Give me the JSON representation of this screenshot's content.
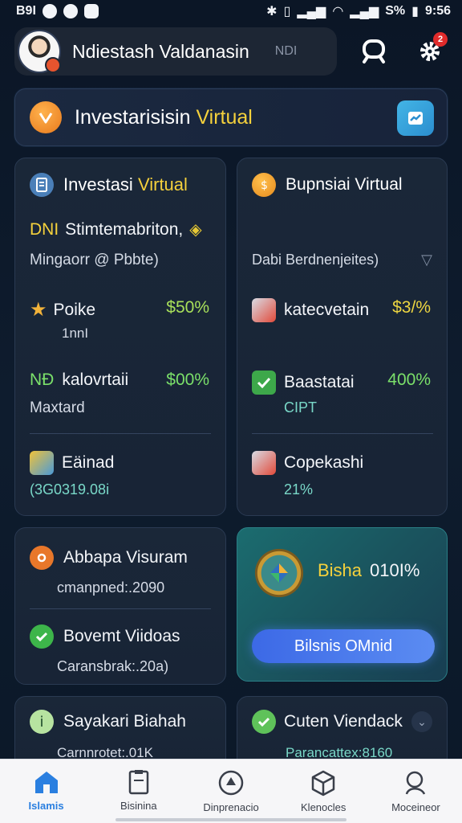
{
  "status_bar": {
    "left_text": "B9I",
    "battery_text": "S%",
    "time": "9:56"
  },
  "header": {
    "username": "Ndiestash Valdanasin",
    "tag": "NDI",
    "notification_count": "2"
  },
  "banner": {
    "title_main": "Investarisisin",
    "title_highlight": "Virtual"
  },
  "left_card": {
    "title_main": "Investasi",
    "title_highlight": "Virtual",
    "line1_prefix": "DNI",
    "line1": "Stimtemabriton,",
    "line2": "Mingaorr @ Pbbte)",
    "item1_label": "Poike",
    "item1_value": "$50%",
    "item1_sub": "1nnI",
    "item2_prefix": "NÐ",
    "item2_label": "kalovrtaii",
    "item2_value": "$00%",
    "item2_sub": "Maxtard",
    "item3_label": "Eäinad",
    "item3_sub": "(3G0319.08i"
  },
  "right_card": {
    "title": "Bupnsiai Virtual",
    "dropdown_value": "Dabi Berdnenjeites)",
    "item1_label": "katecvetain",
    "item1_value": "$3/%",
    "item2_label": "Baastatai",
    "item2_value": "400%",
    "item2_sub": "CIPT",
    "item3_label": "Copekashi",
    "item3_sub": "21%"
  },
  "left_mid_card": {
    "item1_label": "Abbapa Visuram",
    "item1_sub": "cmanpned:.2090",
    "item2_label": "Bovemt Viidoas",
    "item2_sub": "Caransbrak:.20a)"
  },
  "promo_card": {
    "label": "Bisha",
    "value": "010I%",
    "button_label": "Bilsnis OMnid"
  },
  "left_low_card": {
    "label": "Sayakari Biahah",
    "sub": "Carnnrotet:.01K"
  },
  "right_low_card": {
    "label": "Cuten Viendack",
    "sub": "Parancattex:8160"
  },
  "bottom_nav": [
    {
      "label": "Islamis",
      "icon": "home-icon"
    },
    {
      "label": "Bisinina",
      "icon": "document-icon"
    },
    {
      "label": "Dinprenacio",
      "icon": "compass-icon"
    },
    {
      "label": "Klenocles",
      "icon": "box-icon"
    },
    {
      "label": "Moceineor",
      "icon": "profile-icon"
    }
  ],
  "colors": {
    "background": "#0b1626",
    "card": "#1a2738",
    "accent_yellow": "#f5d13c",
    "accent_green": "#7be06a",
    "accent_teal": "#79d8c8",
    "nav_active": "#2a7fe0"
  }
}
